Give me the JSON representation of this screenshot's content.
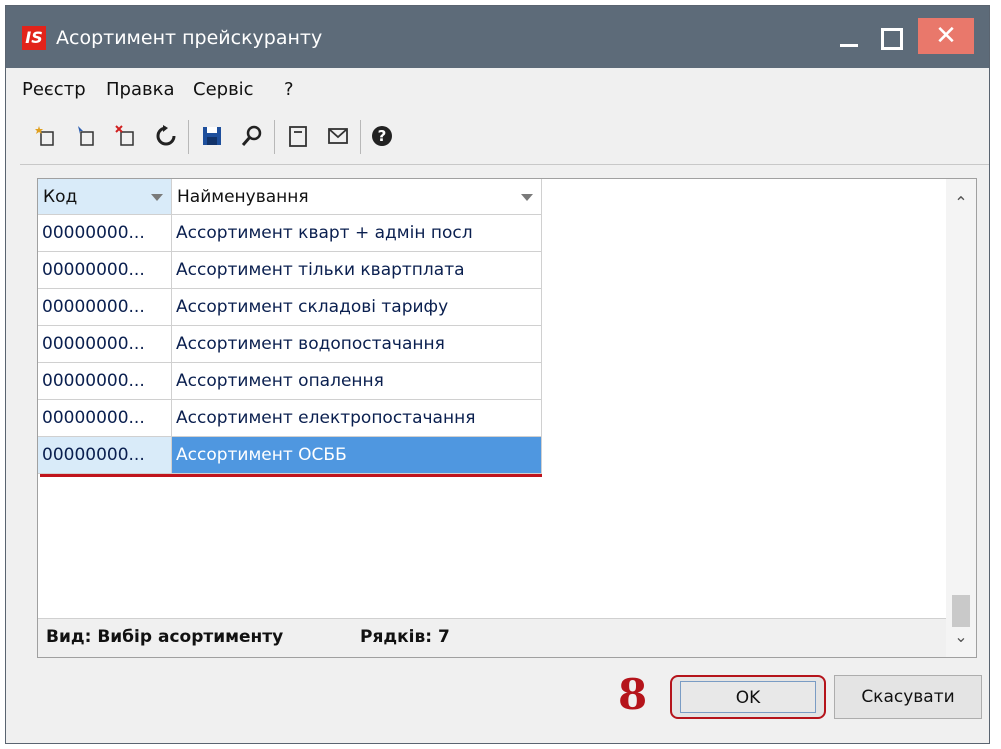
{
  "window": {
    "title": "Асортимент прейскуранту",
    "logo_text": "IS",
    "close_glyph": "✕"
  },
  "menu": {
    "items": [
      "Реєстр",
      "Правка",
      "Сервіс",
      "?"
    ]
  },
  "toolbar": {
    "icons": [
      "create-icon",
      "copy-icon",
      "delete-icon",
      "refresh-icon",
      "save-icon",
      "search-icon",
      "card-icon",
      "mail-icon",
      "help-icon"
    ]
  },
  "grid": {
    "columns": [
      "Код",
      "Найменування"
    ],
    "rows": [
      {
        "code": "00000000...",
        "name": "Ассортимент кварт + адмін посл"
      },
      {
        "code": "00000000...",
        "name": "Ассортимент тільки квартплата"
      },
      {
        "code": "00000000...",
        "name": "Ассортимент складові тарифу"
      },
      {
        "code": "00000000...",
        "name": "Ассортимент водопостачання"
      },
      {
        "code": "00000000...",
        "name": "Ассортимент опалення"
      },
      {
        "code": "00000000...",
        "name": "Ассортимент електропостачання"
      },
      {
        "code": "00000000...",
        "name": "Ассортимент ОСББ"
      }
    ],
    "selected_row": 6
  },
  "status": {
    "view": "Вид: Вибір асортименту",
    "rows": "Рядків: 7"
  },
  "annotation": {
    "step": "8"
  },
  "buttons": {
    "ok": "OK",
    "cancel": "Скасувати"
  },
  "colors": {
    "titlebar": "#5d6b79",
    "close": "#e9786b",
    "selected": "#4f97e0",
    "highlight": "#b5141b"
  }
}
